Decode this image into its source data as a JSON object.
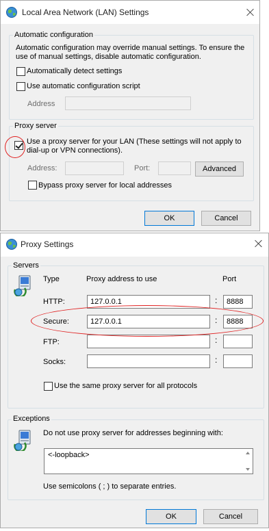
{
  "lan_dialog": {
    "title": "Local Area Network (LAN) Settings",
    "auto_config": {
      "legend": "Automatic configuration",
      "description_line1": "Automatic configuration may override manual settings.  To ensure the",
      "description_line2": "use of manual settings, disable automatic configuration.",
      "auto_detect_label": "Automatically detect settings",
      "auto_detect_checked": false,
      "use_script_label": "Use automatic configuration script",
      "use_script_checked": false,
      "address_label": "Address",
      "address_value": ""
    },
    "proxy_server": {
      "legend": "Proxy server",
      "use_proxy_label_line1": "Use a proxy server for your LAN (These settings will not apply to",
      "use_proxy_label_line2": "dial-up or VPN connections).",
      "use_proxy_checked": true,
      "address_label": "Address:",
      "address_value": "",
      "port_label": "Port:",
      "port_value": "",
      "advanced_label": "Advanced",
      "bypass_label": "Bypass proxy server for local addresses",
      "bypass_checked": false
    },
    "ok_label": "OK",
    "cancel_label": "Cancel"
  },
  "proxy_dialog": {
    "title": "Proxy Settings",
    "servers": {
      "legend": "Servers",
      "col_type": "Type",
      "col_address": "Proxy address to use",
      "col_port": "Port",
      "rows": [
        {
          "type": "HTTP:",
          "address": "127.0.0.1",
          "port": "8888"
        },
        {
          "type": "Secure:",
          "address": "127.0.0.1",
          "port": "8888"
        },
        {
          "type": "FTP:",
          "address": "",
          "port": ""
        },
        {
          "type": "Socks:",
          "address": "",
          "port": ""
        }
      ],
      "colon": ":",
      "same_proxy_label": "Use the same proxy server for all protocols",
      "same_proxy_checked": false
    },
    "exceptions": {
      "legend": "Exceptions",
      "description": "Do not use proxy server for addresses beginning with:",
      "value": "<-loopback>",
      "hint": "Use semicolons ( ; ) to separate entries."
    },
    "ok_label": "OK",
    "cancel_label": "Cancel"
  },
  "colors": {
    "dialog_bg": "#f0f0f0",
    "annotation": "#e02020",
    "default_button_border": "#0078d7"
  },
  "icons": [
    "globe-network-icon",
    "close-icon",
    "computer-network-icon"
  ]
}
